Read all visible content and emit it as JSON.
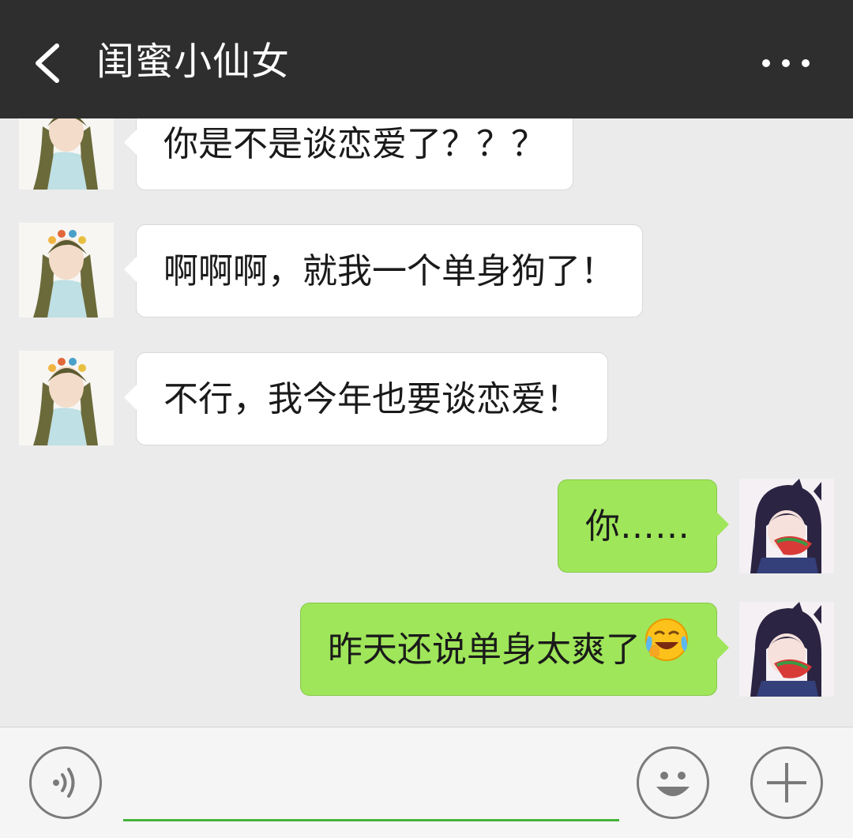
{
  "header": {
    "title": "闺蜜小仙女",
    "back_icon": "chevron-left-icon",
    "more_icon": "more-dots-icon",
    "background": "#2e2e2e"
  },
  "messages": [
    {
      "sender": "friend",
      "text": "你是不是谈恋爱了？？？"
    },
    {
      "sender": "friend",
      "text": "啊啊啊，就我一个单身狗了！"
    },
    {
      "sender": "friend",
      "text": "不行，我今年也要谈恋爱！"
    },
    {
      "sender": "me",
      "text": "你……"
    },
    {
      "sender": "me",
      "text": "昨天还说单身太爽了",
      "emoji": "face-with-tears-of-joy-icon"
    }
  ],
  "colors": {
    "chat_background": "#ebebeb",
    "incoming_bubble": "#ffffff",
    "outgoing_bubble": "#9fe65a",
    "input_underline": "#46b33c"
  },
  "input_bar": {
    "voice_icon": "voice-icon",
    "emoji_icon": "smiley-icon",
    "plus_icon": "plus-icon",
    "value": ""
  }
}
